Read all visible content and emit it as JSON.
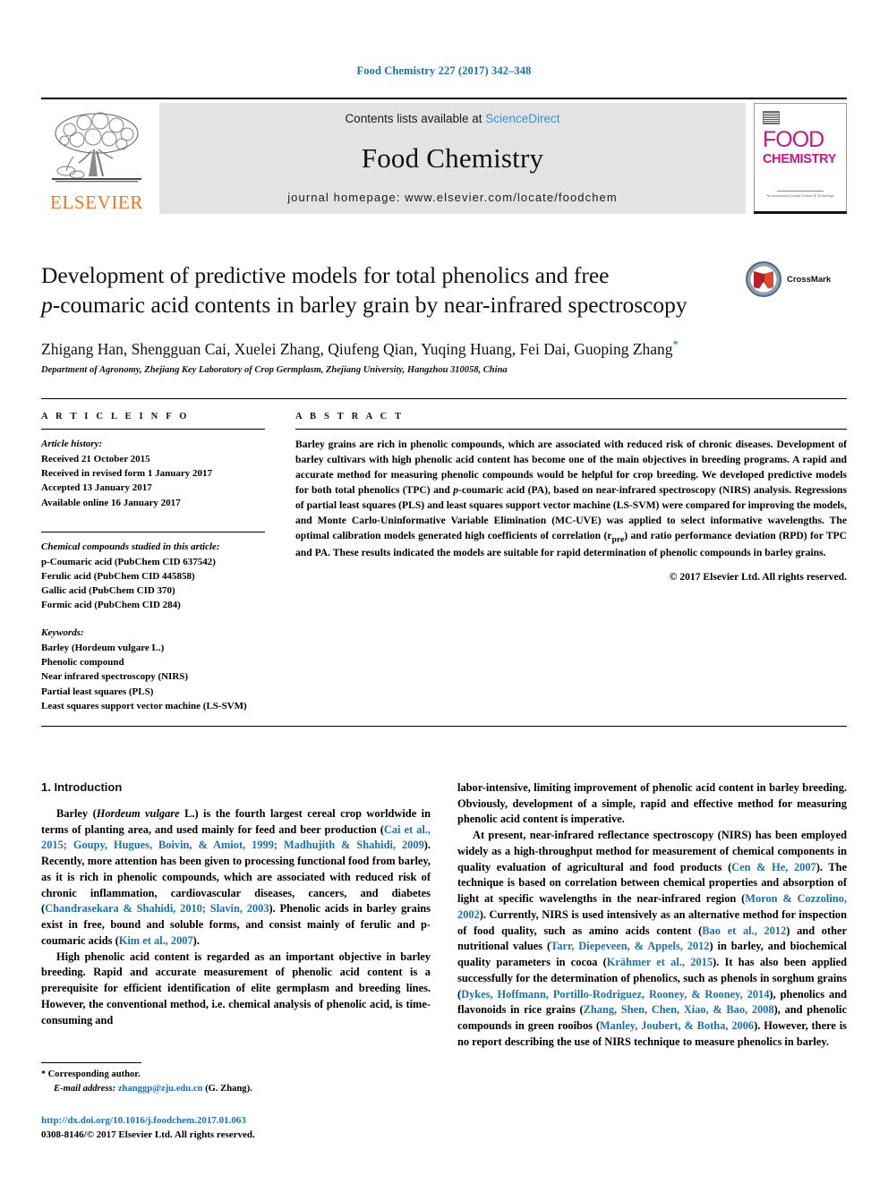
{
  "running_head": "Food Chemistry 227 (2017) 342–348",
  "masthead": {
    "publisher_logo_label": "ELSEVIER",
    "contents_prefix": "Contents lists available at ",
    "contents_link": "ScienceDirect",
    "journal_name": "Food Chemistry",
    "homepage": "journal homepage: www.elsevier.com/locate/foodchem",
    "cover": {
      "line1": "FOOD",
      "line2": "CHEMISTRY",
      "footer": "An international journal\nScience & Technology"
    }
  },
  "article": {
    "title_line1": "Development of predictive models for total phenolics and free",
    "title_line2_pre": "",
    "title_italic": "p",
    "title_line2_post": "-coumaric acid contents in barley grain by near-infrared spectroscopy",
    "crossmark_label": "CrossMark",
    "authors": "Zhigang Han, Shengguan Cai, Xuelei Zhang, Qiufeng Qian, Yuqing Huang, Fei Dai, Guoping Zhang",
    "corresponding_marker": "*",
    "affiliation": "Department of Agronomy, Zhejiang Key Laboratory of Crop Germplasm, Zhejiang University, Hangzhou 310058, China"
  },
  "article_info": {
    "heading": "A R T I C L E  I N F O",
    "history_label": "Article history:",
    "history": [
      "Received 21 October 2015",
      "Received in revised form 1 January 2017",
      "Accepted 13 January 2017",
      "Available online 16 January 2017"
    ],
    "compounds_label": "Chemical compounds studied in this article:",
    "compounds": [
      "p-Coumaric acid (PubChem CID 637542)",
      "Ferulic acid (PubChem CID 445858)",
      "Gallic acid (PubChem CID 370)",
      "Formic acid (PubChem CID 284)"
    ],
    "keywords_label": "Keywords:",
    "keywords": [
      "Barley (Hordeum vulgare L.)",
      "Phenolic compound",
      "Near infrared spectroscopy (NIRS)",
      "Partial least squares (PLS)",
      "Least squares support vector machine (LS-SVM)"
    ]
  },
  "abstract": {
    "heading": "A B S T R A C T",
    "text_part1": "Barley grains are rich in phenolic compounds, which are associated with reduced risk of chronic diseases. Development of barley cultivars with high phenolic acid content has become one of the main objectives in breeding programs. A rapid and accurate method for measuring phenolic compounds would be helpful for crop breeding. We developed predictive models for both total phenolics (TPC) and ",
    "text_italic1": "p",
    "text_part2": "-coumaric acid (PA), based on near-infrared spectroscopy (NIRS) analysis. Regressions of partial least squares (PLS) and least squares support vector machine (LS-SVM) were compared for improving the models, and Monte Carlo-Uninformative Variable Elimination (MC-UVE) was applied to select informative wavelengths. The optimal calibration models generated high coefficients of correlation (r",
    "subscript": "pre",
    "text_part3": ") and ratio performance deviation (RPD) for TPC and PA. These results indicated the models are suitable for rapid determination of phenolic compounds in barley grains.",
    "copyright": "© 2017 Elsevier Ltd. All rights reserved."
  },
  "introduction": {
    "heading": "1. Introduction",
    "left_paragraphs": [
      {
        "segments": [
          {
            "t": "Barley (",
            "s": "plain"
          },
          {
            "t": "Hordeum vulgare",
            "s": "italic"
          },
          {
            "t": " L.) is the fourth largest cereal crop worldwide in terms of planting area, and used mainly for feed and beer production (",
            "s": "plain"
          },
          {
            "t": "Cai et al., 2015; Goupy, Hugues, Boivin, & Amiot, 1999; Madhujith & Shahidi, 2009",
            "s": "ref"
          },
          {
            "t": "). Recently, more attention has been given to processing functional food from barley, as it is rich in phenolic compounds, which are associated with reduced risk of chronic inflammation, cardiovascular diseases, cancers, and diabetes (",
            "s": "plain"
          },
          {
            "t": "Chandrasekara & Shahidi, 2010; Slavin, 2003",
            "s": "ref"
          },
          {
            "t": "). Phenolic acids in barley grains exist in free, bound and soluble forms, and consist mainly of ferulic and p-coumaric acids (",
            "s": "plain"
          },
          {
            "t": "Kim et al., 2007",
            "s": "ref"
          },
          {
            "t": ").",
            "s": "plain"
          }
        ]
      },
      {
        "segments": [
          {
            "t": "High phenolic acid content is regarded as an important objective in barley breeding. Rapid and accurate measurement of phenolic acid content is a prerequisite for efficient identification of elite germplasm and breeding lines. However, the conventional method, i.e. chemical analysis of phenolic acid, is time-consuming and",
            "s": "plain"
          }
        ]
      }
    ],
    "right_paragraphs": [
      {
        "no_indent": true,
        "segments": [
          {
            "t": "labor-intensive, limiting improvement of phenolic acid content in barley breeding. Obviously, development of a simple, rapid and effective method for measuring phenolic acid content is imperative.",
            "s": "plain"
          }
        ]
      },
      {
        "segments": [
          {
            "t": "At present, near-infrared reflectance spectroscopy (NIRS) has been employed widely as a high-throughput method for measurement of chemical components in quality evaluation of agricultural and food products (",
            "s": "plain"
          },
          {
            "t": "Cen & He, 2007",
            "s": "ref"
          },
          {
            "t": "). The technique is based on correlation between chemical properties and absorption of light at specific wavelengths in the near-infrared region (",
            "s": "plain"
          },
          {
            "t": "Moron & Cozzolino, 2002",
            "s": "ref"
          },
          {
            "t": "). Currently, NIRS is used intensively as an alternative method for inspection of food quality, such as amino acids content (",
            "s": "plain"
          },
          {
            "t": "Bao et al., 2012",
            "s": "ref"
          },
          {
            "t": ") and other nutritional values (",
            "s": "plain"
          },
          {
            "t": "Tarr, Diepeveen, & Appels, 2012",
            "s": "ref"
          },
          {
            "t": ") in barley, and biochemical quality parameters in cocoa (",
            "s": "plain"
          },
          {
            "t": "Krähmer et al., 2015",
            "s": "ref"
          },
          {
            "t": "). It has also been applied successfully for the determination of phenolics, such as phenols in sorghum grains (",
            "s": "plain"
          },
          {
            "t": "Dykes, Hoffmann, Portillo-Rodriguez, Rooney, & Rooney, 2014",
            "s": "ref"
          },
          {
            "t": "), phenolics and flavonoids in rice grains (",
            "s": "plain"
          },
          {
            "t": "Zhang, Shen, Chen, Xiao, & Bao, 2008",
            "s": "ref"
          },
          {
            "t": "), and phenolic compounds in green rooibos (",
            "s": "plain"
          },
          {
            "t": "Manley, Joubert, & Botha, 2006",
            "s": "ref"
          },
          {
            "t": "). However, there is no report describing the use of NIRS technique to measure phenolics in barley.",
            "s": "plain"
          }
        ]
      }
    ]
  },
  "footnote": {
    "corresponding_star": "*",
    "corresponding_text": "Corresponding author.",
    "email_label": "E-mail address:",
    "email": "zhanggp@zju.edu.cn",
    "email_suffix": "(G. Zhang).",
    "doi": "http://dx.doi.org/10.1016/j.foodchem.2017.01.063",
    "issn": "0308-8146/© 2017 Elsevier Ltd. All rights reserved."
  },
  "colors": {
    "link_blue": "#1a72a8",
    "sciencedirect_blue": "#3f8fd0",
    "elsevier_orange": "#e87722",
    "cover_magenta": "#c6168d",
    "masthead_grey": "#e3e3e3"
  }
}
